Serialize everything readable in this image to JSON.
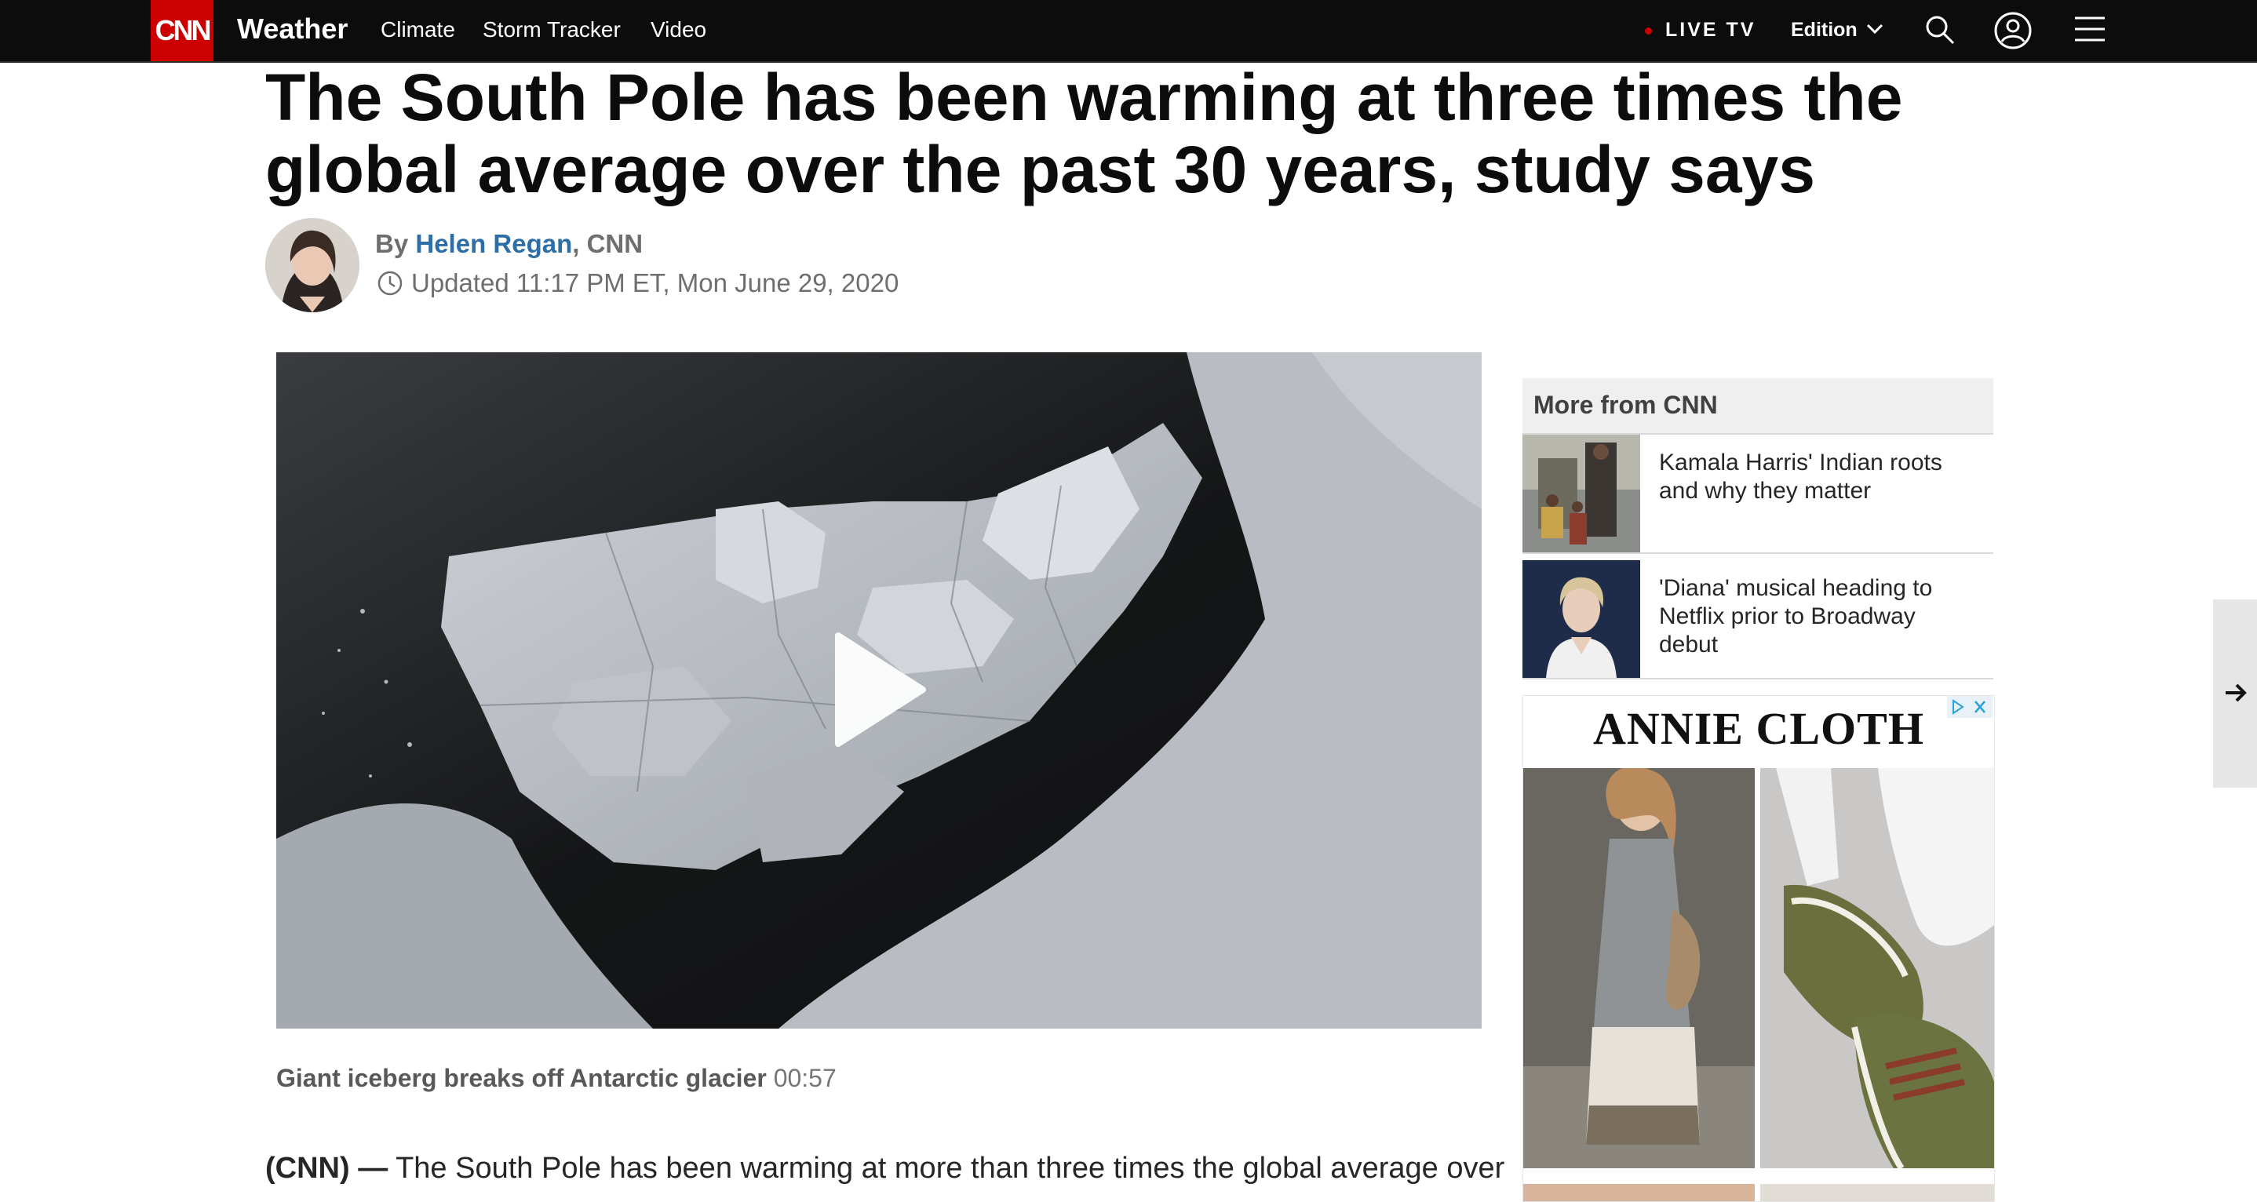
{
  "nav": {
    "logo": "CNN",
    "section": "Weather",
    "links": [
      "Climate",
      "Storm Tracker",
      "Video"
    ],
    "live_tv": "LIVE TV",
    "edition": "Edition"
  },
  "article": {
    "headline": "The South Pole has been warming at three times the global average over the past 30 years, study says",
    "byline_prefix": "By ",
    "author": "Helen Regan",
    "outlet": ", CNN",
    "updated": "Updated 11:17 PM ET, Mon June 29, 2020",
    "video_caption_title": "Giant iceberg breaks off Antarctic glacier",
    "video_duration": "00:57",
    "lede_source": "(CNN) —",
    "lede_text": " The South Pole has been warming at more than three times the global average over"
  },
  "sidebar": {
    "title": "More from CNN",
    "stories": [
      {
        "text": "Kamala Harris' Indian roots and why they matter"
      },
      {
        "text": "'Diana' musical heading to Netflix prior to Broadway debut"
      }
    ]
  },
  "ad": {
    "brand": "ANNIE CLOTH"
  },
  "colors": {
    "nav_bg": "#0c0c0c",
    "brand_red": "#cc0000",
    "author_link": "#2e6ea6"
  }
}
